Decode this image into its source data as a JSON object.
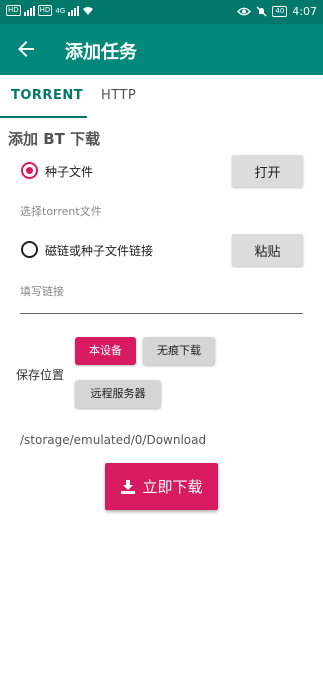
{
  "status_bar": {
    "left_chips": [
      "HD",
      "HD"
    ],
    "network": "4G",
    "battery": "40",
    "time": "4:07"
  },
  "app_bar": {
    "title": "添加任务"
  },
  "tabs": [
    {
      "label": "TORRENT",
      "active": true
    },
    {
      "label": "HTTP",
      "active": false
    }
  ],
  "form": {
    "section_title": "添加 BT 下载",
    "torrent_option": {
      "label": "种子文件",
      "selected": true,
      "button_label": "打开",
      "hint": "选择torrent文件"
    },
    "magnet_option": {
      "label": "磁链或种子文件链接",
      "selected": false,
      "button_label": "粘贴",
      "placeholder": "填写链接"
    },
    "save_location": {
      "label": "保存位置",
      "options": [
        {
          "label": "本设备",
          "selected": true
        },
        {
          "label": "无痕下载",
          "selected": false
        },
        {
          "label": "远程服务器",
          "selected": false
        }
      ],
      "path": "/storage/emulated/0/Download"
    },
    "download_button": "立即下载"
  },
  "colors": {
    "status_bar": "#00796b",
    "app_bar": "#00897b",
    "accent": "#d81b60",
    "tab_active": "#00796b"
  }
}
